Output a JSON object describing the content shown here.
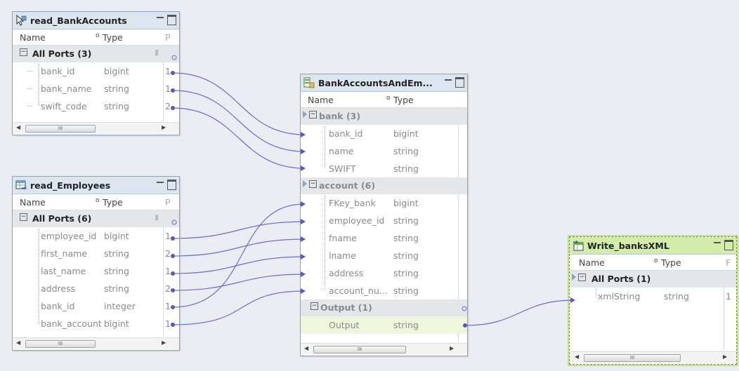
{
  "nodes": {
    "read_bank_accounts": {
      "title": "read_BankAccounts",
      "col_name": "Name",
      "col_type": "Type",
      "col_cut": "P",
      "group": "All Ports (3)",
      "rows": [
        {
          "name": "bank_id",
          "type": "bigint",
          "cut": "1"
        },
        {
          "name": "bank_name",
          "type": "string",
          "cut": "1"
        },
        {
          "name": "swift_code",
          "type": "string",
          "cut": "2"
        }
      ]
    },
    "read_employees": {
      "title": "read_Employees",
      "col_name": "Name",
      "col_type": "Type",
      "col_cut": "P",
      "group": "All Ports (6)",
      "rows": [
        {
          "name": "employee_id",
          "type": "bigint",
          "cut": "1"
        },
        {
          "name": "first_name",
          "type": "string",
          "cut": "2"
        },
        {
          "name": "last_name",
          "type": "string",
          "cut": "1"
        },
        {
          "name": "address",
          "type": "string",
          "cut": "2"
        },
        {
          "name": "bank_id",
          "type": "integer",
          "cut": "1"
        },
        {
          "name": "bank_account",
          "type": "bigint",
          "cut": "1"
        }
      ]
    },
    "bank_accounts_and_employees": {
      "title": "BankAccountsAndEm...",
      "col_name": "Name",
      "col_type": "Type",
      "groups": {
        "bank": {
          "label": "bank (3)",
          "rows": [
            {
              "name": "bank_id",
              "type": "bigint"
            },
            {
              "name": "name",
              "type": "string"
            },
            {
              "name": "SWIFT",
              "type": "string"
            }
          ]
        },
        "account": {
          "label": "account (6)",
          "rows": [
            {
              "name": "FKey_bank",
              "type": "bigint"
            },
            {
              "name": "employee_id",
              "type": "string"
            },
            {
              "name": "fname",
              "type": "string"
            },
            {
              "name": "lname",
              "type": "string"
            },
            {
              "name": "address",
              "type": "string"
            },
            {
              "name": "account_nu...",
              "type": "string"
            }
          ]
        },
        "output": {
          "label": "Output (1)",
          "rows": [
            {
              "name": "Output",
              "type": "string"
            }
          ]
        }
      }
    },
    "write_banks_xml": {
      "title": "Write_banksXML",
      "col_name": "Name",
      "col_type": "Type",
      "col_cut": "F",
      "group": "All Ports (1)",
      "rows": [
        {
          "name": "xmlString",
          "type": "string",
          "cut": "1"
        }
      ]
    }
  },
  "scroll_thumb_glyph": "III",
  "colors": {
    "canvas": "#eaeef3",
    "title_bar": "#dbe6f1",
    "selected_title_bar": "#d4ecaa",
    "link": "#6a6ad8",
    "group_row": "#e4e7ea",
    "port_text": "#8a8a8a"
  },
  "icons": {
    "read_bank_accounts": "read-source-icon",
    "read_employees": "read-table-icon",
    "bank_accounts_and_employees": "joiner-icon",
    "write_banks_xml": "write-target-icon"
  }
}
